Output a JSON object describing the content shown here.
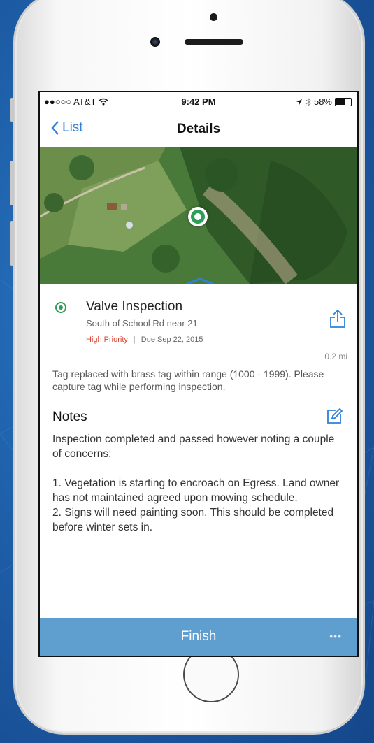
{
  "status_bar": {
    "carrier": "●●○○○ AT&T",
    "time": "9:42 PM",
    "battery_pct": "58%",
    "battery_level": 0.58
  },
  "nav": {
    "back_label": "List",
    "title": "Details"
  },
  "item": {
    "title": "Valve Inspection",
    "address": "South of School Rd near 21",
    "priority": "High Priority",
    "separator": "|",
    "due": "Due Sep 22, 2015",
    "distance": "0.2 mi",
    "status_color": "#2e9d56"
  },
  "description": "Tag replaced with brass tag within range (1000 - 1999). Please capture tag while performing inspection.",
  "notes": {
    "heading": "Notes",
    "body": "Inspection completed and passed however noting a couple of concerns:\n\n1. Vegetation is starting to encroach on Egress. Land owner has not maintained agreed upon mowing schedule.\n2. Signs will need painting soon. This should be completed before winter sets in."
  },
  "footer": {
    "finish_label": "Finish",
    "more_label": "•••"
  },
  "colors": {
    "accent": "#2f80d8",
    "footer": "#5f9fcf",
    "priority": "#d64532"
  }
}
